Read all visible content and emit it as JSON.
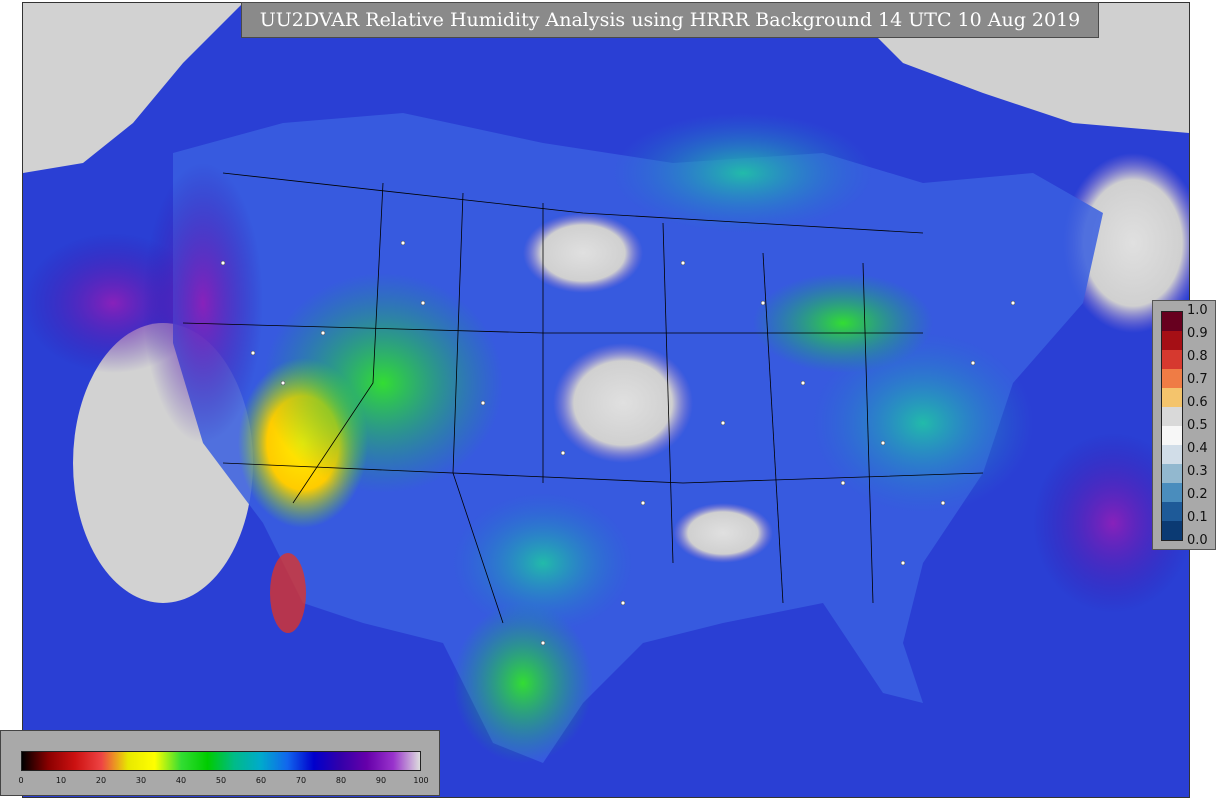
{
  "title": "UU2DVAR Relative Humidity Analysis using HRRR Background 14 UTC 10 Aug 2019",
  "legend_right": {
    "labels": [
      "1.0",
      "0.9",
      "0.8",
      "0.7",
      "0.6",
      "0.5",
      "0.4",
      "0.3",
      "0.2",
      "0.1",
      "0.0"
    ],
    "colors": [
      "#67001f",
      "#a50f15",
      "#d6392f",
      "#ef7c45",
      "#f4c46c",
      "#d9d9d9",
      "#f7f7f7",
      "#d1dde8",
      "#92b8cf",
      "#4a8dbd",
      "#1e5a98",
      "#0b3a73"
    ]
  },
  "colorbar": {
    "ticks": [
      "0",
      "10",
      "20",
      "30",
      "40",
      "50",
      "60",
      "70",
      "80",
      "90",
      "100"
    ],
    "gradient": [
      "#000000",
      "#8b0000",
      "#cc1111",
      "#ee4444",
      "#e8e800",
      "#ffff00",
      "#33dd33",
      "#00cc00",
      "#00bb88",
      "#00aacc",
      "#1166ee",
      "#0000cc",
      "#3300aa",
      "#6600aa",
      "#9933cc",
      "#dddddd"
    ]
  },
  "map": {
    "background_color": "#d2d2d2",
    "ocean_color": "#2233cc",
    "country_border_color": "#000000"
  }
}
